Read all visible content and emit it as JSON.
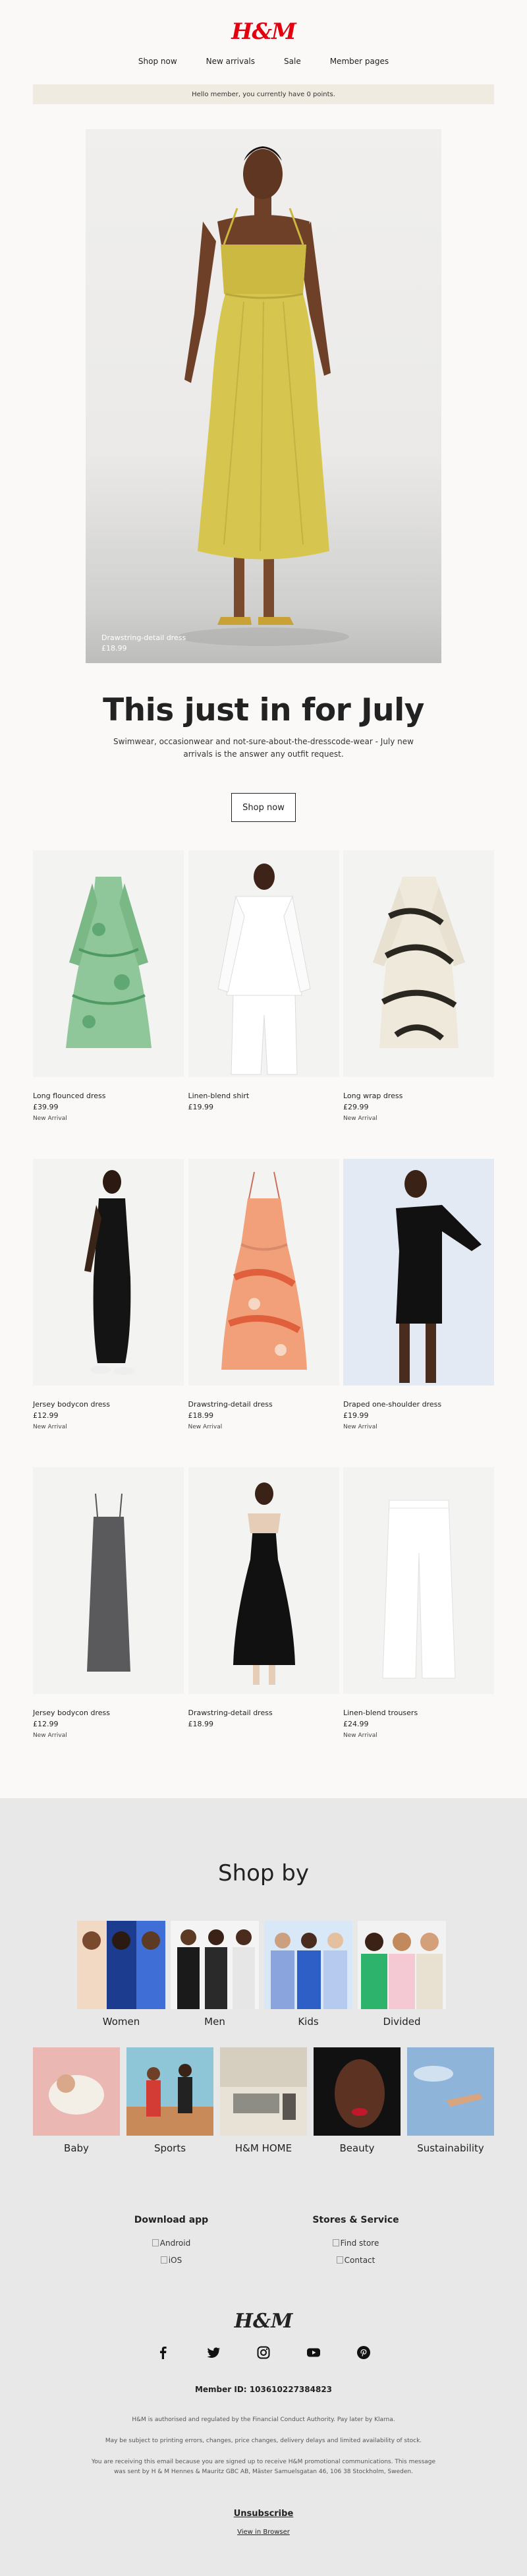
{
  "brand": {
    "logo": "H&M",
    "color": "#e50010"
  },
  "nav": {
    "items": [
      "Shop now",
      "New arrivals",
      "Sale",
      "Member pages"
    ]
  },
  "banner": {
    "text": "Hello member, you currently have 0 points."
  },
  "hero": {
    "product_name": "Drawstring-detail dress",
    "price": "£18.99"
  },
  "headline": {
    "title": "This just in for July",
    "subtitle": "Swimwear, occasionwear and not-sure-about-the-dresscode-wear - July new arrivals is the answer any outfit request.",
    "cta": "Shop now"
  },
  "products": [
    {
      "name": "Long flounced dress",
      "price": "£39.99",
      "tag": "New Arrival"
    },
    {
      "name": "Linen-blend shirt",
      "price": "£19.99",
      "tag": ""
    },
    {
      "name": "Long wrap dress",
      "price": "£29.99",
      "tag": "New Arrival"
    },
    {
      "name": "Jersey bodycon dress",
      "price": "£12.99",
      "tag": "New Arrival"
    },
    {
      "name": "Drawstring-detail dress",
      "price": "£18.99",
      "tag": "New Arrival"
    },
    {
      "name": "Draped one-shoulder dress",
      "price": "£19.99",
      "tag": "New Arrival"
    },
    {
      "name": "Jersey bodycon dress",
      "price": "£12.99",
      "tag": "New Arrival"
    },
    {
      "name": "Drawstring-detail dress",
      "price": "£18.99",
      "tag": ""
    },
    {
      "name": "Linen-blend trousers",
      "price": "£24.99",
      "tag": "New Arrival"
    }
  ],
  "shop_by": {
    "title": "Shop by",
    "row1": [
      "Women",
      "Men",
      "Kids",
      "Divided"
    ],
    "row2": [
      "Baby",
      "Sports",
      "H&M HOME",
      "Beauty",
      "Sustainability"
    ]
  },
  "footer": {
    "download_title": "Download app",
    "download_links": [
      "Android",
      "iOS"
    ],
    "stores_title": "Stores & Service",
    "stores_links": [
      "Find store",
      "Contact"
    ],
    "logo": "H&M",
    "social_icons": [
      "facebook-icon",
      "twitter-icon",
      "instagram-icon",
      "youtube-icon",
      "pinterest-icon"
    ],
    "member_id": "Member ID: 103610227384823",
    "legal1": "H&M is authorised and regulated by the Financial Conduct Authority. Pay later by Klarna.",
    "legal2": "May be subject to printing errors, changes, price changes, delivery delays and limited availability of stock.",
    "legal3": "You are receiving this email because you are signed up to receive H&M promotional communications. This message was sent by H & M Hennes & Mauritz GBC AB, Mäster Samuelsgatan 46, 106 38 Stockholm, Sweden.",
    "unsubscribe": "Unsubscribe",
    "view_in_browser": "View in Browser"
  }
}
